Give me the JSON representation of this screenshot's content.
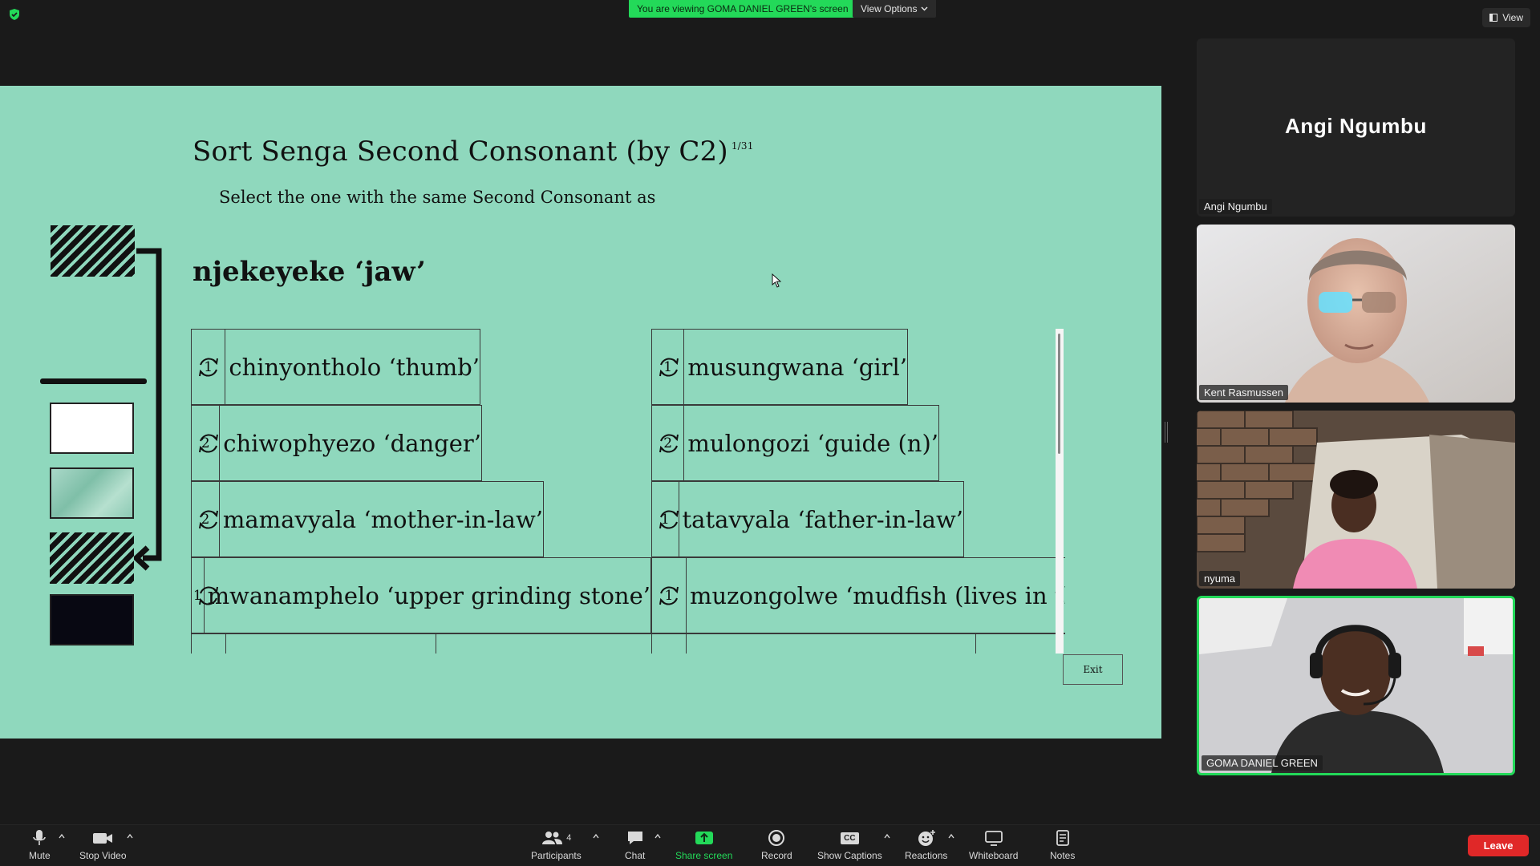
{
  "top_bar": {
    "viewing_banner": "You are viewing GOMA DANIEL GREEN's screen",
    "view_options_label": "View Options",
    "view_label": "View"
  },
  "slide": {
    "title": "Sort Senga Second Consonant (by C2)",
    "counter": "1/31",
    "instruction": "Select the one with the same Second Consonant as",
    "target_word": "njekeyeke ‘jaw’",
    "exit_label": "Exit",
    "options_left": [
      {
        "num": "1",
        "text": "chinyontholo ‘thumb’"
      },
      {
        "num": "2",
        "text": "chiwophyezo ‘danger’"
      },
      {
        "num": "2",
        "text": "mamavyala ‘mother-in-law’"
      },
      {
        "num": "1",
        "text": "mwanamphelo ‘upper grinding stone’"
      }
    ],
    "options_right": [
      {
        "num": "1",
        "text": "musungwana ‘girl’"
      },
      {
        "num": "2",
        "text": "mulongozi ‘guide (n)’"
      },
      {
        "num": "1",
        "text": "tatavyala ‘father-in-law’"
      },
      {
        "num": "1",
        "text": "muzongolwe ‘mudfish (lives in th"
      }
    ]
  },
  "participants": [
    {
      "name": "Angi Ngumbu",
      "video": false
    },
    {
      "name": "Kent Rasmussen",
      "video": true
    },
    {
      "name": "nyuma",
      "video": true
    },
    {
      "name": "GOMA DANIEL GREEN",
      "video": true,
      "active_speaker": true
    }
  ],
  "toolbar": {
    "mute": "Mute",
    "stop_video": "Stop Video",
    "participants": "Participants",
    "participants_count": "4",
    "chat": "Chat",
    "share_screen": "Share screen",
    "record": "Record",
    "show_captions": "Show Captions",
    "captions_badge": "CC",
    "reactions": "Reactions",
    "whiteboard": "Whiteboard",
    "notes": "Notes",
    "leave": "Leave"
  },
  "colors": {
    "slide_background": "#8fd8bd",
    "banner_green": "#23d959",
    "leave_red": "#e02828",
    "window_background": "#1a1a1a"
  }
}
